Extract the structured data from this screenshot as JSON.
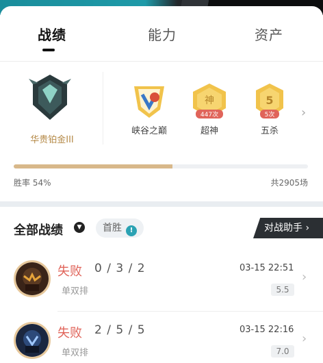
{
  "tabs": [
    {
      "label": "战绩",
      "active": true
    },
    {
      "label": "能力",
      "active": false
    },
    {
      "label": "资产",
      "active": false
    }
  ],
  "rank": {
    "label": "华贵铂金III",
    "icon": "platinum-rank-emblem-icon"
  },
  "badges": [
    {
      "name": "峡谷之巅",
      "icon": "peak-badge-icon",
      "mark": ""
    },
    {
      "name": "超神",
      "icon": "godlike-badge-icon",
      "mark": "神",
      "count": "447次"
    },
    {
      "name": "五杀",
      "icon": "pentakill-badge-icon",
      "mark": "5",
      "count": "5次"
    }
  ],
  "stats": {
    "win_rate_text": "胜率 54%",
    "win_rate": 0.54,
    "total_text": "共2905场"
  },
  "list": {
    "title": "全部战绩",
    "first_win": "首胜",
    "assistant": "对战助手 ›"
  },
  "matches": [
    {
      "result": "失败",
      "kda": "0 / 3 / 2",
      "mode": "单双排",
      "time": "03-15 22:51",
      "score": "5.5"
    },
    {
      "result": "失败",
      "kda": "2 / 5 / 5",
      "mode": "单双排",
      "time": "03-15 22:16",
      "score": "7.0"
    }
  ],
  "colors": {
    "accent_gold": "#d8b88a",
    "loss_red": "#e0645a",
    "teal": "#2ba2b3"
  }
}
